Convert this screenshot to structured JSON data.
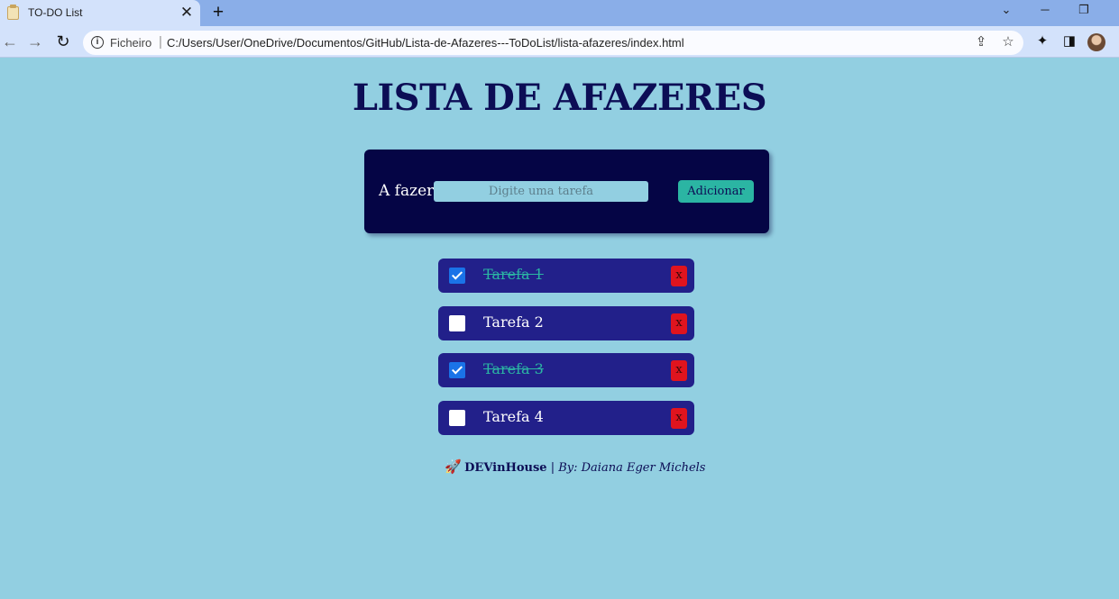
{
  "browser": {
    "tab_title": "TO-DO List",
    "tab_close": "✕",
    "new_tab": "+",
    "address_scheme": "Ficheiro",
    "address_separator": "|",
    "address_url": "C:/Users/User/OneDrive/Documentos/GitHub/Lista-de-Afazeres---ToDoList/lista-afazeres/index.html",
    "icons": {
      "back": "←",
      "forward": "→",
      "reload": "↻",
      "info": "i",
      "share": "⇪",
      "star": "☆",
      "extensions": "✦",
      "sidepanel": "◨",
      "chevron": "⌄",
      "minimize": "─",
      "restore": "❐"
    }
  },
  "page": {
    "title": "LISTA DE AFAZERES",
    "form": {
      "label": "A fazer:",
      "placeholder": "Digite uma tarefa",
      "value": "",
      "add_button": "Adicionar"
    },
    "tasks": [
      {
        "text": "Tarefa 1",
        "done": true,
        "delete_label": "x"
      },
      {
        "text": "Tarefa 2",
        "done": false,
        "delete_label": "x"
      },
      {
        "text": "Tarefa 3",
        "done": true,
        "delete_label": "x"
      },
      {
        "text": "Tarefa 4",
        "done": false,
        "delete_label": "x"
      }
    ],
    "footer": {
      "icon": "🚀",
      "brand": "DEVinHouse",
      "byline": " | By: Daiana Eger Michels"
    }
  },
  "colors": {
    "page_bg": "#92cfe1",
    "title": "#0c0d55",
    "form_bg": "#050545",
    "task_bg": "#22208a",
    "accent_teal": "#2bb5a3",
    "delete_red": "#e0141e"
  }
}
